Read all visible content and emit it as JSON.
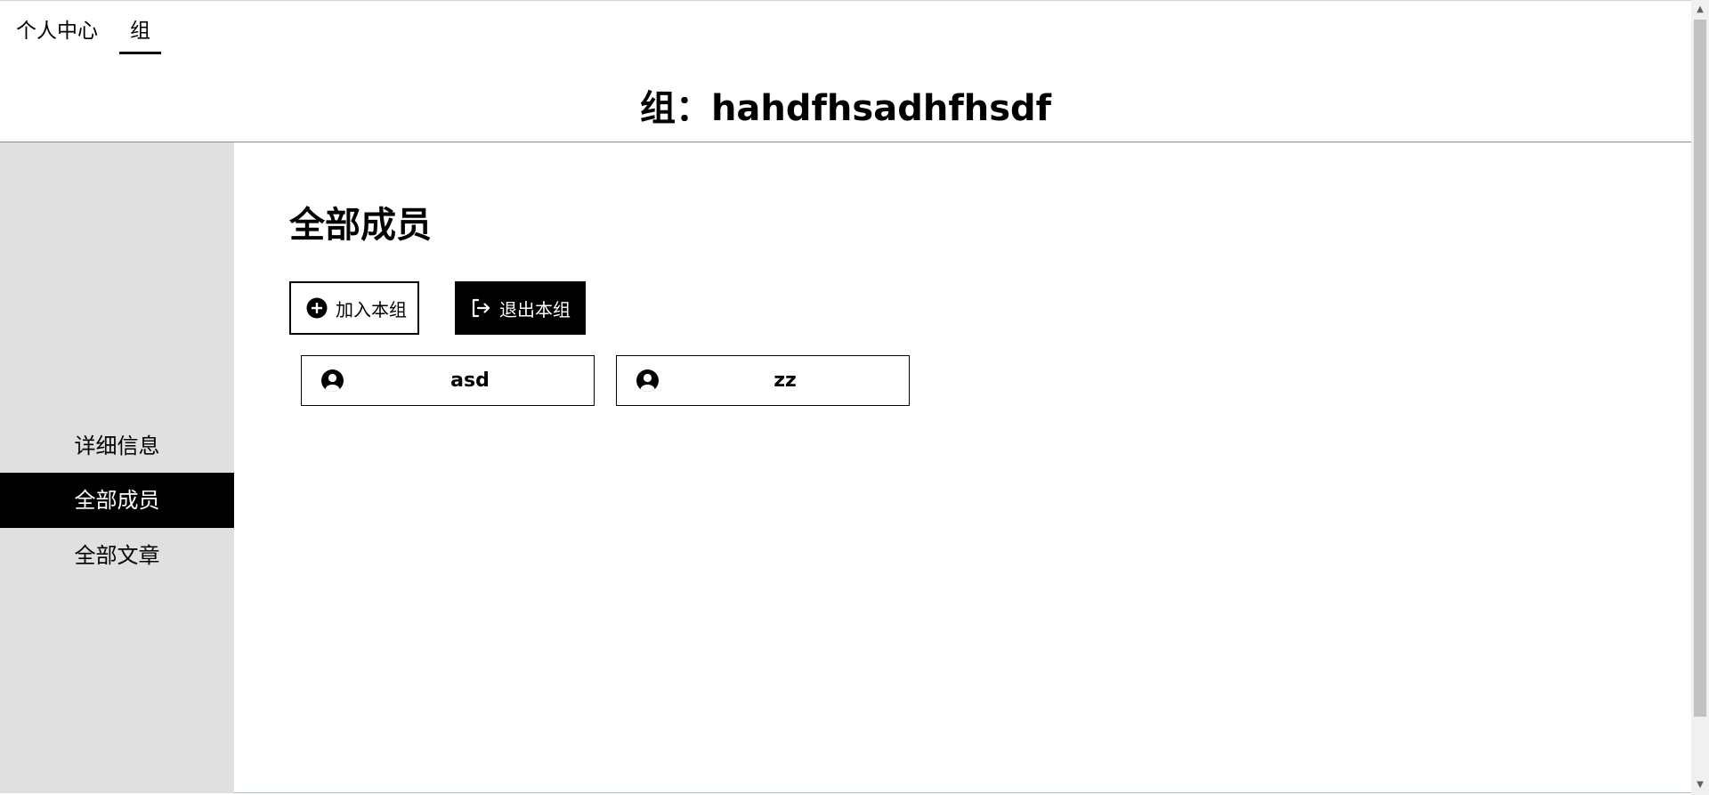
{
  "topnav": {
    "tabs": [
      {
        "label": "个人中心",
        "active": false
      },
      {
        "label": "组",
        "active": true
      }
    ]
  },
  "page": {
    "title": "组：hahdfhsadhfhsdf"
  },
  "sidebar": {
    "items": [
      {
        "label": "详细信息",
        "active": false
      },
      {
        "label": "全部成员",
        "active": true
      },
      {
        "label": "全部文章",
        "active": false
      }
    ]
  },
  "main": {
    "heading": "全部成员",
    "join_button": {
      "label": "加入本组",
      "icon": "plus-circle-icon"
    },
    "leave_button": {
      "label": "退出本组",
      "icon": "logout-icon"
    },
    "members": [
      {
        "name": "asd",
        "icon": "user-circle-icon"
      },
      {
        "name": "zz",
        "icon": "user-circle-icon"
      }
    ]
  },
  "colors": {
    "sidebar_bg": "#e0e0e0",
    "active_bg": "#000000",
    "active_text": "#ffffff",
    "scrollbar_thumb": "#c1c1c1"
  }
}
